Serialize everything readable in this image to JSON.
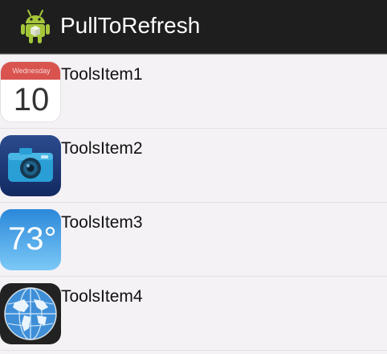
{
  "app": {
    "title": "PullToRefresh"
  },
  "list": {
    "items": [
      {
        "label": "ToolsItem1",
        "icon": "calendar-icon",
        "calendar_weekday": "Wednesday",
        "calendar_day": "10"
      },
      {
        "label": "ToolsItem2",
        "icon": "camera-icon"
      },
      {
        "label": "ToolsItem3",
        "icon": "weather-icon",
        "weather_temp": "73°"
      },
      {
        "label": "ToolsItem4",
        "icon": "globe-icon"
      }
    ]
  },
  "colors": {
    "actionbar": "#1e1e1e",
    "background": "#f5f2f6",
    "android_green": "#a4c639",
    "calendar_red": "#d9534f"
  }
}
